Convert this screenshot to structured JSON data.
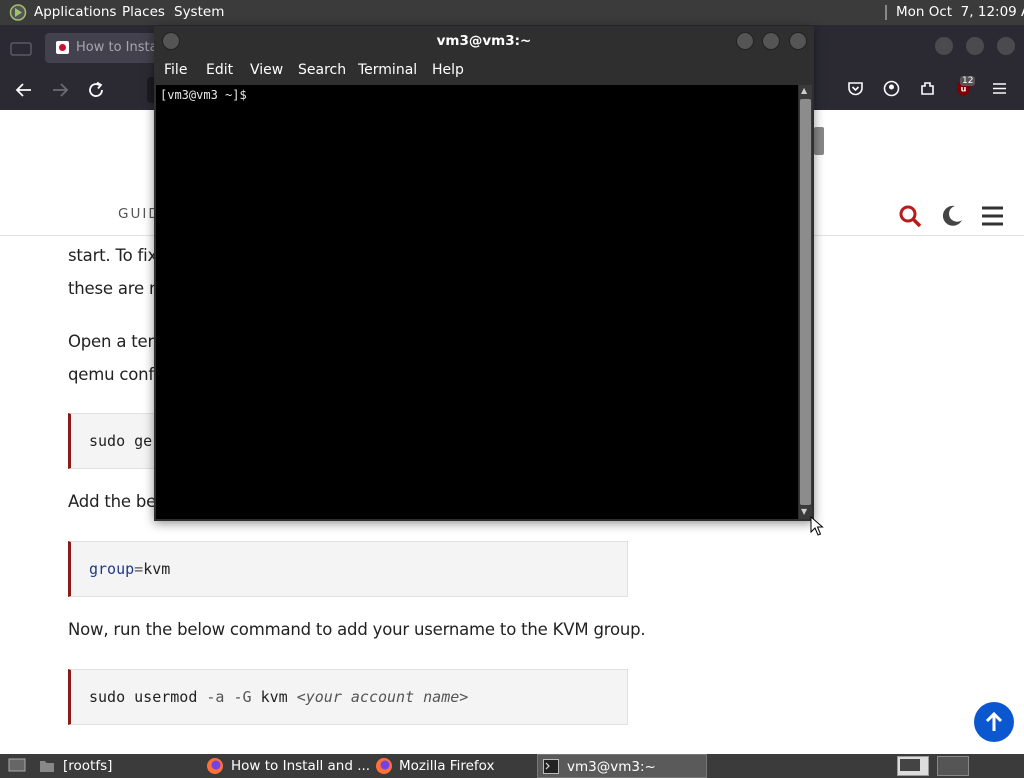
{
  "top_panel": {
    "menus": [
      "Applications",
      "Places",
      "System"
    ],
    "clock": "Mon Oct  7, 12:09 AM"
  },
  "firefox": {
    "tab_title": "How to Instal",
    "toolbar_badge": "12"
  },
  "page": {
    "nav_label": "GUID",
    "para1_line1": "start. To fix",
    "para1_line2": "these are n",
    "para2_line1": "Open a tern",
    "para2_line2": "qemu conf",
    "code1_text": "sudo ge",
    "para3": "Add the be",
    "code2": {
      "keyword": "group",
      "op": "=",
      "value": "kvm"
    },
    "para4": "Now, run the below command to add your username to the KVM group.",
    "code3": {
      "cmd": "sudo usermod ",
      "flag1": "-a",
      "flag2": " -G",
      "arg": " kvm ",
      "placeholder": "<your account name>"
    }
  },
  "terminal": {
    "title": "vm3@vm3:~",
    "menu": [
      "File",
      "Edit",
      "View",
      "Search",
      "Terminal",
      "Help"
    ],
    "prompt": "[vm3@vm3 ~]$"
  },
  "taskbar": {
    "items": [
      "[rootfs]",
      "How to Install and ...",
      "Mozilla Firefox",
      "vm3@vm3:~"
    ]
  },
  "colors": {
    "accent_red": "#8b1a1a",
    "scroll_top_blue": "#0b57d0"
  }
}
